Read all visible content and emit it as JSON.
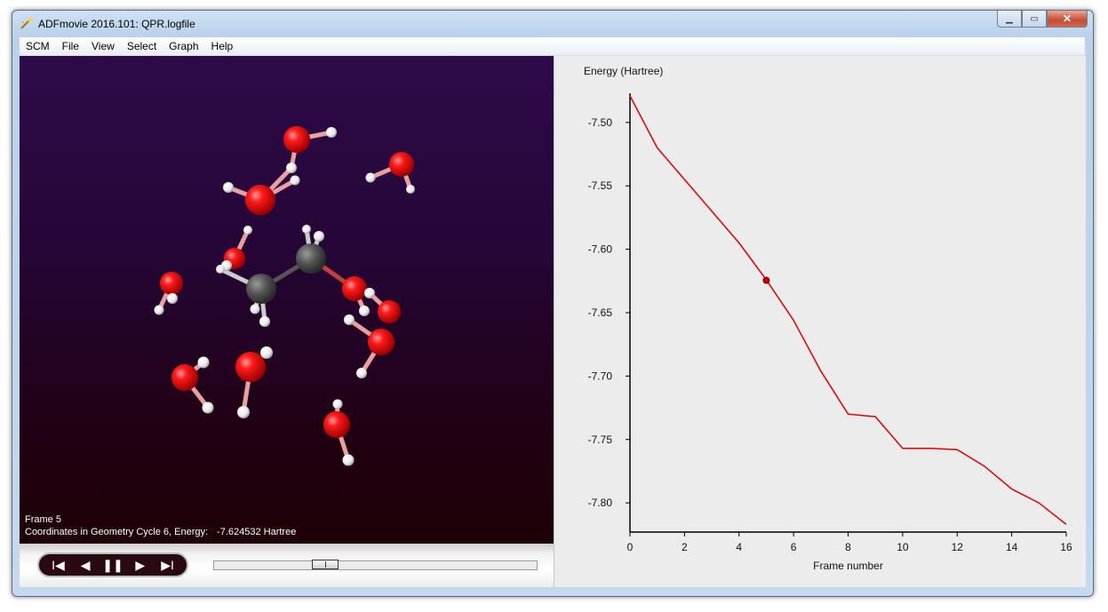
{
  "window": {
    "title": "ADFmovie 2016.101: QPR.logfile",
    "min_symbol": "▁",
    "max_symbol": "▭",
    "close_symbol": "✕"
  },
  "menu": [
    "SCM",
    "File",
    "View",
    "Select",
    "Graph",
    "Help"
  ],
  "viewer": {
    "frame_label": "Frame 5",
    "coords_label": "Coordinates in Geometry Cycle 6, Energy:",
    "energy_value": "-7.624532 Hartree",
    "background_top": "#2e0a4a",
    "background_bottom": "#1d0006"
  },
  "controls": {
    "buttons": [
      {
        "name": "first-frame",
        "icon": "skip-back-icon",
        "glyph": "I◀"
      },
      {
        "name": "previous-frame",
        "icon": "play-back-icon",
        "glyph": "◀"
      },
      {
        "name": "pause",
        "icon": "pause-icon",
        "glyph": "❚❚"
      },
      {
        "name": "next-frame",
        "icon": "play-icon",
        "glyph": "▶"
      },
      {
        "name": "last-frame",
        "icon": "skip-forward-icon",
        "glyph": "▶I"
      }
    ],
    "slider_fraction": 0.33
  },
  "chart_data": {
    "type": "line",
    "ylabel": "Energy (Hartree)",
    "xlabel": "Frame number",
    "xlim": [
      0,
      16
    ],
    "ylim": [
      -7.823,
      -7.477
    ],
    "x_ticks": [
      0,
      2,
      4,
      6,
      8,
      10,
      12,
      14,
      16
    ],
    "y_ticks": [
      -7.5,
      -7.55,
      -7.6,
      -7.65,
      -7.7,
      -7.75,
      -7.8
    ],
    "y_tick_labels": [
      "-7.50",
      "-7.55",
      "-7.60",
      "-7.65",
      "-7.70",
      "-7.75",
      "-7.80"
    ],
    "series": [
      {
        "color": "#e00000",
        "x": [
          0,
          1,
          2,
          3,
          4,
          5,
          6,
          7,
          8,
          9,
          10,
          11,
          12,
          13,
          14,
          15,
          16
        ],
        "values": [
          -7.479,
          -7.52,
          -7.545,
          -7.57,
          -7.595,
          -7.624,
          -7.656,
          -7.696,
          -7.73,
          -7.732,
          -7.757,
          -7.757,
          -7.758,
          -7.771,
          -7.789,
          -7.8,
          -7.817
        ]
      }
    ],
    "marker": {
      "x": 5,
      "y": -7.624532,
      "color": "#cc0000"
    }
  },
  "molecule": {
    "oxygen_color": "#ff0000",
    "hydrogen_color": "#ffffff",
    "carbon_color": "#555555"
  }
}
